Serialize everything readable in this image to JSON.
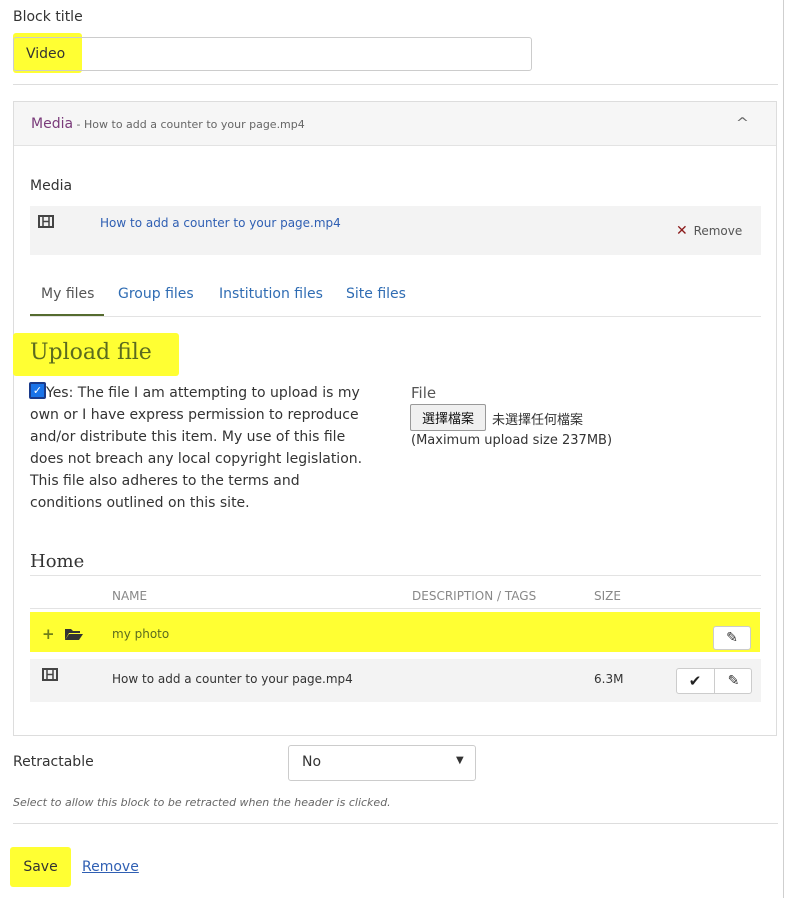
{
  "block_title": {
    "label": "Block title",
    "value": "Video"
  },
  "media_panel": {
    "header_title": "Media",
    "header_subtitle": " - How to add a counter to your page.mp4",
    "media_label": "Media",
    "selected_file": "How to add a counter to your page.mp4",
    "remove_label": "Remove"
  },
  "tabs": [
    "My files",
    "Group files",
    "Institution files",
    "Site files"
  ],
  "upload": {
    "heading": "Upload file",
    "agreement_text": "Yes: The file I am attempting to upload is my own or I have express permission to reproduce and/or distribute this item. My use of this file does not breach any local copyright legislation. This file also adheres to the terms and conditions outlined on this site.",
    "file_label": "File",
    "choose_button": "選擇檔案",
    "no_file_text": "未選擇任何檔案",
    "max_size": "(Maximum upload size 237MB)",
    "agreement_checked": true
  },
  "files_table": {
    "heading": "Home",
    "columns": {
      "name": "NAME",
      "description": "DESCRIPTION / TAGS",
      "size": "SIZE"
    },
    "rows": [
      {
        "type": "folder",
        "name": "my photo",
        "size": ""
      },
      {
        "type": "file",
        "name": "How to add a counter to your page.mp4",
        "size": "6.3M"
      }
    ]
  },
  "retractable": {
    "label": "Retractable",
    "value": "No",
    "help": "Select to allow this block to be retracted when the header is clicked."
  },
  "actions": {
    "save": "Save",
    "remove": "Remove"
  },
  "icons": {
    "folder_plus": "+",
    "chevron": "^",
    "check": "✔",
    "edit": "✎",
    "remove": "✕",
    "caret": "▼"
  },
  "colors": {
    "highlight": "#ffff33",
    "link": "#2f5fb3",
    "accent": "#5b6b1f",
    "media_title": "#7a3b7a",
    "remove_x": "#8b1a1a"
  }
}
